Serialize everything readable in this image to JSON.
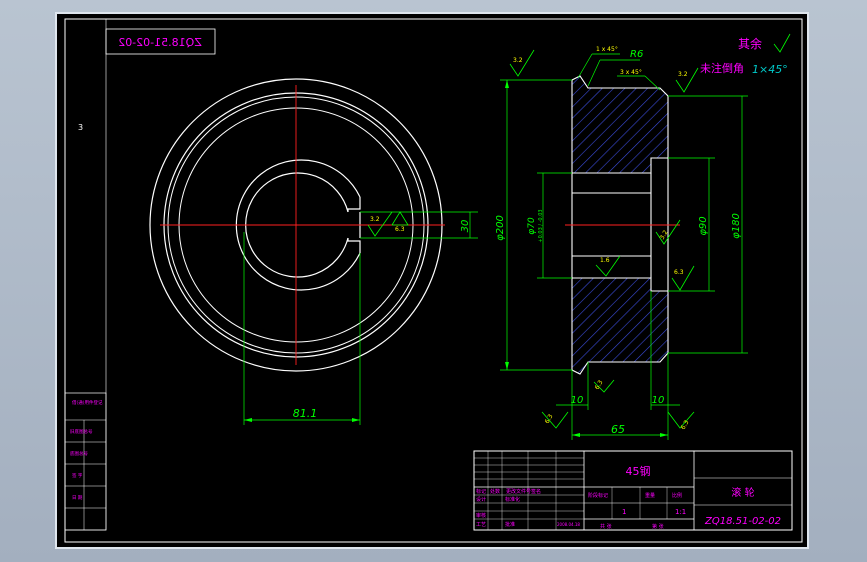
{
  "drawing": {
    "mirrored_code": "ZQ18.51-02-02",
    "side_mark": "3",
    "roughness_note": "其余",
    "chamfer_note": "未注倒角",
    "chamfer_value": "1×45°",
    "chamfer_top_left": "1 x 45°",
    "chamfer_top_right": "3 x 45°",
    "radius": "R6",
    "dim_key_depth": "30",
    "dim_width_81": "81.1",
    "dim_outer_dia": "φ200",
    "dim_bore_dia": "φ70",
    "dim_bore_tol": "+0.03 / -0.03",
    "dim_counterbore": "φ90",
    "dim_hub_dia": "φ180",
    "dim_10_left": "10",
    "dim_10_right": "10",
    "dim_65": "65",
    "rough_32_a": "3.2",
    "rough_32_b": "3.2",
    "rough_32_c": "3.2",
    "rough_32_d": "3.2",
    "rough_63_a": "6.3",
    "rough_63_b": "6.3",
    "rough_63_c": "6.3",
    "rough_63_d": "6.3",
    "rough_63_e": "6.3",
    "rough_16": "1.6"
  },
  "title_block": {
    "material": "45钢",
    "part_name": "滚 轮",
    "drawing_no": "ZQ18.51-02-02",
    "scale": "1:1",
    "quantity": "1",
    "weight_label": "重量",
    "scale_label": "比例",
    "stage_mark": "阶段标记",
    "design": "设计",
    "check": "审核",
    "process": "工艺",
    "standard": "标准化",
    "approve": "批准",
    "date": "2008.04.18",
    "sheets_total": "共 张",
    "sheet_no": "第 张",
    "mark": "标记",
    "count": "处数",
    "zone": "分区",
    "change_doc": "更改文件号",
    "sign": "签名",
    "year_month_day": "年月日"
  },
  "side_table": {
    "rows": [
      "借(通)用件登记",
      "旧底图总号",
      "底图总号",
      "签 字",
      "日 期"
    ]
  },
  "colors": {
    "paper": "#000000",
    "line": "#ffffff",
    "center": "#ff2020",
    "dimension": "#00ff00",
    "text_magenta": "#ff00ff",
    "hatch": "#3a4bd8",
    "frame_outer": "#ffffff"
  }
}
